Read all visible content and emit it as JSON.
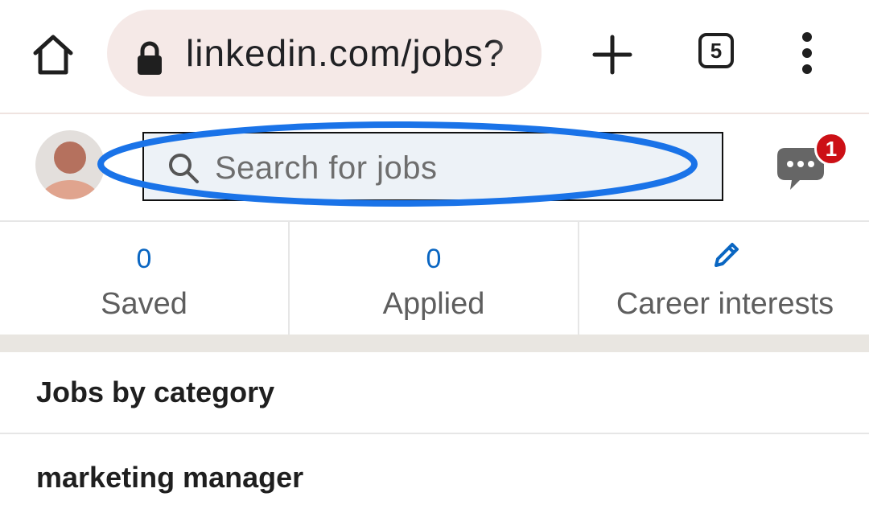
{
  "browser": {
    "url": "linkedin.com/jobs?",
    "tab_count": "5",
    "icons": {
      "home": "home-icon",
      "lock": "lock-icon",
      "new_tab": "plus-icon",
      "menu": "more-vert-icon"
    }
  },
  "header": {
    "search_placeholder": "Search for jobs",
    "message_badge_count": "1",
    "icons": {
      "search": "search-icon",
      "messaging": "messaging-icon",
      "avatar": "avatar"
    },
    "highlight_color": "#1a73e8"
  },
  "stats": [
    {
      "value": "0",
      "label": "Saved"
    },
    {
      "value": "0",
      "label": "Applied"
    },
    {
      "label": "Career interests",
      "icon": "pencil-icon"
    }
  ],
  "list": [
    {
      "label": "Jobs by category"
    },
    {
      "label": "marketing manager"
    }
  ],
  "colors": {
    "accent": "#0a66c2",
    "badge": "#cc1016",
    "omnibox": "#f5e9e7",
    "search_bg": "#edf2f7"
  }
}
